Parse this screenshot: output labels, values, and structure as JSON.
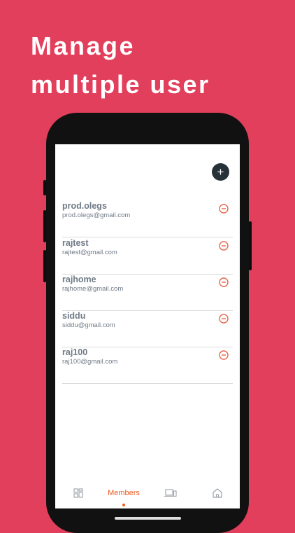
{
  "headline": {
    "line1": "Manage",
    "line2": "multiple user"
  },
  "members": [
    {
      "name": "prod.olegs",
      "email": "prod.olegs@gmail.com"
    },
    {
      "name": "rajtest",
      "email": "rajtest@gmail.com"
    },
    {
      "name": "rajhome",
      "email": "rajhome@gmail.com"
    },
    {
      "name": "siddu",
      "email": "siddu@gmail.com"
    },
    {
      "name": "raj100",
      "email": "raj100@gmail.com"
    }
  ],
  "tabs": {
    "members_label": "Members",
    "icons": [
      "dashboard-icon",
      "devices-icon",
      "home-icon"
    ]
  },
  "colors": {
    "background": "#e23f5c",
    "accent": "#f05a22",
    "remove": "#e8654a"
  }
}
